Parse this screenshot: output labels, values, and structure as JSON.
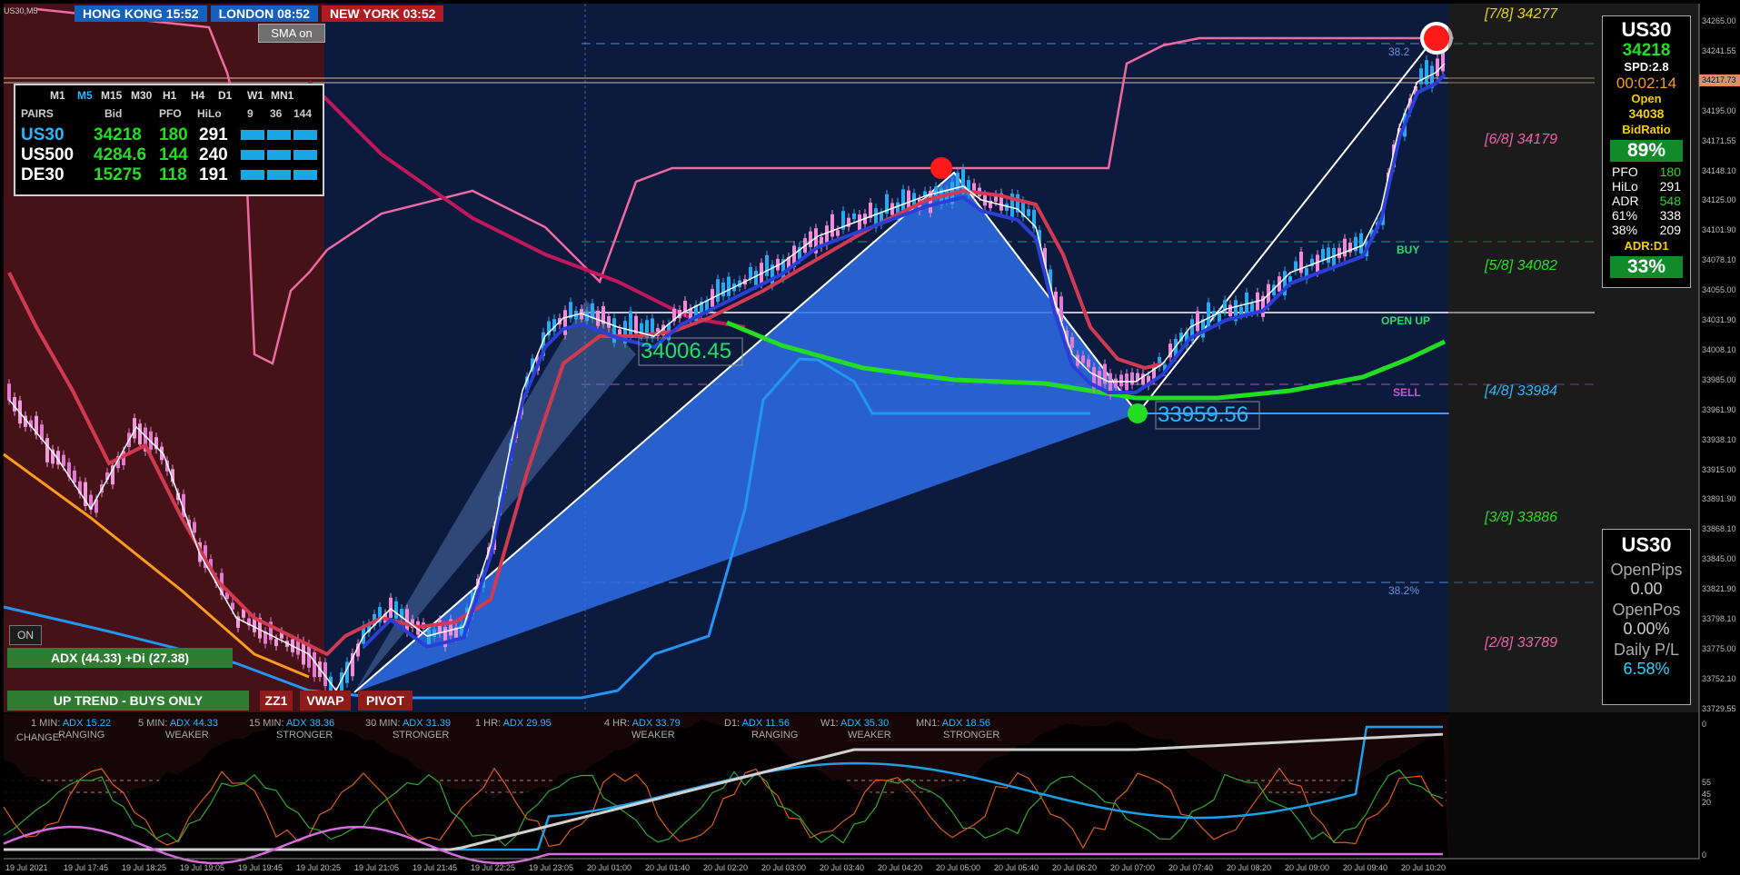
{
  "window": {
    "symbol_label": "US30,M5"
  },
  "clocks": [
    {
      "label": "HONG KONG 15:52",
      "color": "#1560bd"
    },
    {
      "label": "LONDON 08:52",
      "color": "#1560bd"
    },
    {
      "label": "NEW YORK 03:52",
      "color": "#b01c22"
    }
  ],
  "sma_button": "SMA on",
  "timeframes": [
    "M1",
    "M5",
    "M15",
    "M30",
    "H1",
    "H4",
    "D1",
    "W1",
    "MN1"
  ],
  "table": {
    "headers": [
      "PAIRS",
      "Bid",
      "PFO",
      "HiLo",
      "9",
      "36",
      "144"
    ],
    "rows": [
      {
        "pair": "US30",
        "bid": "34218",
        "pfo": "180",
        "hilo": "291"
      },
      {
        "pair": "US500",
        "bid": "4284.6",
        "pfo": "144",
        "hilo": "240"
      },
      {
        "pair": "DE30",
        "bid": "15275",
        "pfo": "118",
        "hilo": "191"
      }
    ]
  },
  "on_button": "ON",
  "adx_badge": "ADX (44.33)   +Di (27.38)",
  "trend_banner": "UP TREND - BUYS ONLY",
  "bottom_buttons": [
    "ZZ1",
    "VWAP",
    "PIVOT"
  ],
  "price_labels": {
    "zz_high": "34006.45",
    "zz_low": "33959.56"
  },
  "fib_levels": [
    {
      "label": "[7/8]  34277",
      "color": "#e6d30a"
    },
    {
      "label": "[6/8]  34179",
      "color": "#ef5da8"
    },
    {
      "label": "[5/8]  34082",
      "color": "#22dd22"
    },
    {
      "label": "[4/8]  33984",
      "color": "#29b6f6"
    },
    {
      "label": "[3/8]  33886",
      "color": "#22dd22"
    },
    {
      "label": "[2/8]  33789",
      "color": "#ef5da8"
    }
  ],
  "line_tags": {
    "buy": "BUY",
    "open_up": "OPEN UP",
    "sell": "SELL",
    "fib_top": "38.2",
    "fib_bottom": "38.2%"
  },
  "info_panel": {
    "symbol": "US30",
    "price": "34218",
    "spread": "SPD:2.8",
    "timer": "00:02:14",
    "open_label": "Open",
    "open_value": "34038",
    "bidratio_label": "BidRatio",
    "bidratio_value": "89%",
    "stats": [
      {
        "k": "PFO",
        "v": "180"
      },
      {
        "k": "HiLo",
        "v": "291"
      },
      {
        "k": "ADR",
        "v": "548"
      },
      {
        "k": "61%",
        "v": "338"
      },
      {
        "k": "38%",
        "v": "209"
      }
    ],
    "adr_label": "ADR:D1",
    "adr_value": "33%"
  },
  "pos_panel": {
    "symbol": "US30",
    "openpips_label": "OpenPips",
    "openpips_value": "0.00",
    "openpos_label": "OpenPos",
    "openpos_value": "0.00%",
    "pl_label": "Daily P/L",
    "pl_value": "6.58%"
  },
  "price_axis": [
    "34265.00",
    "34241.55",
    "34217.73",
    "34195.00",
    "34171.55",
    "34148.10",
    "34125.00",
    "34101.90",
    "34078.10",
    "34055.00",
    "34031.90",
    "34008.10",
    "33985.00",
    "33961.90",
    "33938.10",
    "33915.00",
    "33891.90",
    "33868.10",
    "33845.00",
    "33821.90",
    "33798.10",
    "33775.00",
    "33752.10",
    "33729.55"
  ],
  "current_price_tag": "34217.73",
  "time_axis": [
    "19 Jul 2021",
    "19 Jul 17:45",
    "19 Jul 18:25",
    "19 Jul 19:05",
    "19 Jul 19:45",
    "19 Jul 20:25",
    "19 Jul 21:05",
    "19 Jul 21:45",
    "19 Jul 22:25",
    "19 Jul 23:05",
    "20 Jul 01:00",
    "20 Jul 01:40",
    "20 Jul 02:20",
    "20 Jul 03:00",
    "20 Jul 03:40",
    "20 Jul 04:20",
    "20 Jul 05:00",
    "20 Jul 05:40",
    "20 Jul 06:20",
    "20 Jul 07:00",
    "20 Jul 07:40",
    "20 Jul 08:20",
    "20 Jul 09:00",
    "20 Jul 09:40",
    "20 Jul 10:20"
  ],
  "adx_panel": [
    {
      "tf": "1 MIN:",
      "v": "ADX 15.22",
      "s": "RANGING"
    },
    {
      "tf": "5 MIN:",
      "v": "ADX 44.33",
      "s": "WEAKER"
    },
    {
      "tf": "15 MIN:",
      "v": "ADX 38.36",
      "s": "STRONGER"
    },
    {
      "tf": "30 MIN:",
      "v": "ADX 31.39",
      "s": "STRONGER"
    },
    {
      "tf": "1 HR:",
      "v": "ADX 29.95",
      "s": ""
    },
    {
      "tf": "4 HR:",
      "v": "ADX 33.79",
      "s": "WEAKER"
    },
    {
      "tf": "D1:",
      "v": "ADX 11.56",
      "s": "RANGING"
    },
    {
      "tf": "W1:",
      "v": "ADX 35.30",
      "s": "WEAKER"
    },
    {
      "tf": "MN1:",
      "v": "ADX 18.56",
      "s": "STRONGER"
    }
  ],
  "adx_change_label": "CHANGE:",
  "adx_axis": [
    "0",
    "55",
    "45",
    "20",
    "0"
  ]
}
